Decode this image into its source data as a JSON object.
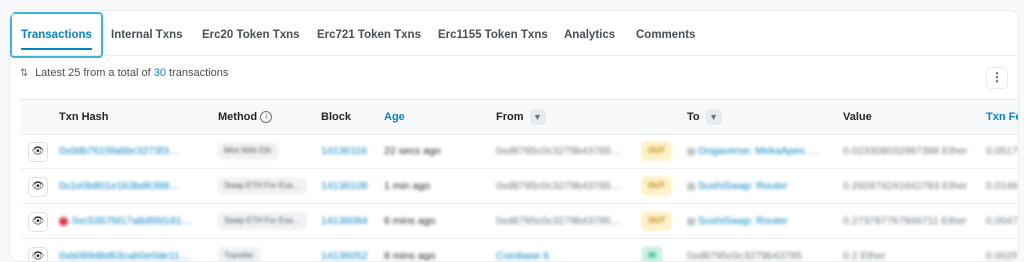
{
  "tabs": [
    {
      "label": "Transactions",
      "active": true
    },
    {
      "label": "Internal Txns"
    },
    {
      "label": "Erc20 Token Txns"
    },
    {
      "label": "Erc721 Token Txns"
    },
    {
      "label": "Erc1155 Token Txns"
    },
    {
      "label": "Analytics"
    },
    {
      "label": "Comments"
    }
  ],
  "summary": {
    "prefix": "Latest 25 from a total of",
    "count": "30",
    "suffix": "transactions"
  },
  "table": {
    "headers": {
      "txn_hash": "Txn Hash",
      "method": "Method",
      "block": "Block",
      "age": "Age",
      "from": "From",
      "to": "To",
      "value": "Value",
      "txn_fee": "Txn Fee"
    },
    "rows": [
      {
        "hash": "0x0db7615fa6bc3273f3…",
        "method": "Mint With Eth",
        "block": "14136116",
        "age": "22 secs ago",
        "from": "0xd8795c0c3279b43785…",
        "direction": "OUT",
        "to": "Oogaverse: MekaApes …",
        "value": "0.023308032997396 Ether",
        "fee": "0.0517"
      },
      {
        "hash": "0x1e0b801e1b3bd6398…",
        "method": "Swap ETH For Exa…",
        "block": "14136108",
        "age": "1 min ago",
        "from": "0xd8795c0c3279b43785…",
        "direction": "OUT",
        "to": "SushiSwap: Router",
        "value": "0.292874241642783 Ether",
        "fee": "0.0146"
      },
      {
        "hash": "0xc5357fd17a8d5fd181…",
        "error": true,
        "method": "Swap ETH For Exa…",
        "block": "14136084",
        "age": "6 mins ago",
        "from": "0xd8795c0c3279b43785…",
        "direction": "OUT",
        "to": "SushiSwap: Router",
        "value": "0.273787767946711 Ether",
        "fee": "0.0047"
      },
      {
        "hash": "0xb089d8d63cab0e0de11…",
        "method": "Transfer",
        "block": "14136052",
        "age": "8 mins ago",
        "from": "Coinbase 6",
        "direction": "IN",
        "to": "0xd8795c0c3279b43785",
        "value": "0.2 Ether",
        "fee": "0.0025"
      }
    ]
  }
}
